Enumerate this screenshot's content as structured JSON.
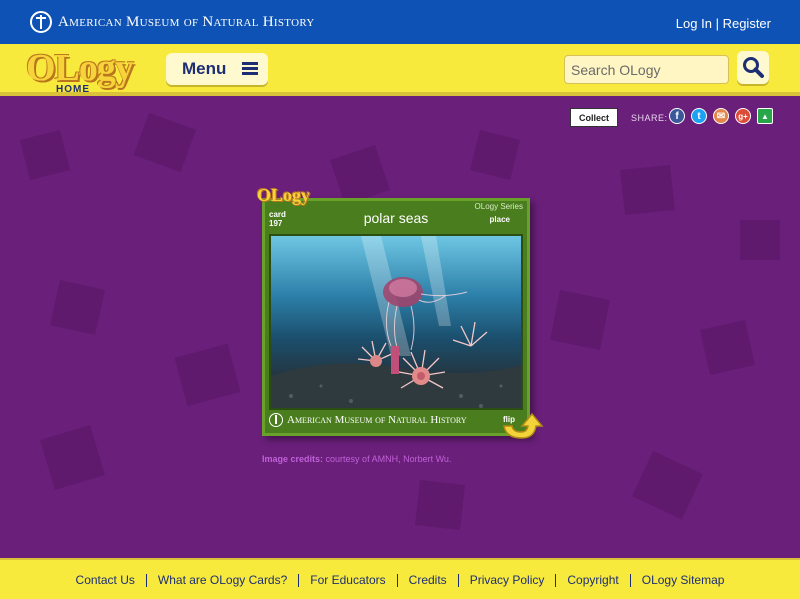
{
  "header": {
    "museum_name": "American Museum of Natural History",
    "login_label": "Log In",
    "separator": "|",
    "register_label": "Register"
  },
  "nav": {
    "logo_word": "OLogy",
    "logo_home": "HOME",
    "menu_label": "Menu",
    "search_placeholder": "Search OLogy"
  },
  "share": {
    "collect_label": "Collect",
    "share_label": "SHARE:",
    "icons": [
      {
        "name": "facebook-icon",
        "glyph": "f",
        "color": "#3b5998"
      },
      {
        "name": "twitter-icon",
        "glyph": "t",
        "color": "#1da1f2"
      },
      {
        "name": "email-icon",
        "glyph": "✉",
        "color": "#e6844a"
      },
      {
        "name": "google-plus-icon",
        "glyph": "g+",
        "color": "#dd4b39"
      },
      {
        "name": "google-classroom-icon",
        "glyph": "▲",
        "color": "#2aa64a"
      }
    ]
  },
  "card": {
    "badge": "OLogy",
    "card_label": "card",
    "card_number": "197",
    "title": "polar seas",
    "series": "OLogy Series",
    "type": "place",
    "footer_museum": "American Museum of Natural History",
    "flip_label": "flip"
  },
  "credits": {
    "label": "Image credits:",
    "text": "courtesy of AMNH, Norbert Wu."
  },
  "footer": {
    "links": [
      "Contact Us",
      "What are OLogy Cards?",
      "For Educators",
      "Credits",
      "Privacy Policy",
      "Copyright",
      "OLogy Sitemap"
    ]
  },
  "colors": {
    "top_bar": "#0d52b4",
    "nav_yellow": "#f7ea3c",
    "page_purple": "#6a1f7a",
    "card_green": "#4a7d1e",
    "navy_text": "#1c2e74"
  }
}
